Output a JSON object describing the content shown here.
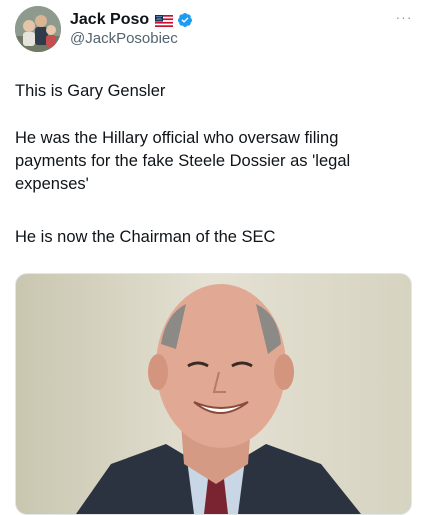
{
  "author": {
    "display_name": "Jack Poso",
    "handle": "@JackPosobiec",
    "flag_icon": "us-flag-icon",
    "verified_icon": "verified-badge-icon",
    "avatar_icon": "profile-photo"
  },
  "menu": {
    "icon": "more-options-icon",
    "label": "···"
  },
  "tweet": {
    "paragraphs": [
      "This is Gary Gensler",
      "He was the Hillary official who oversaw filing payments for the fake Steele Dossier as 'legal expenses'",
      "He is now the Chairman of the SEC"
    ]
  },
  "media": {
    "type": "photo"
  },
  "colors": {
    "text": "#0f1419",
    "secondary_text": "#536471",
    "verified_blue": "#1d9bf0"
  }
}
